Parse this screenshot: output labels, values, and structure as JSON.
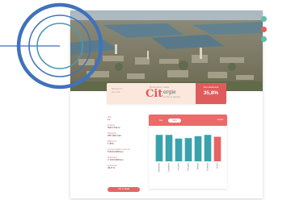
{
  "infobar": {
    "left_caption_line1": "Rendement",
    "left_caption_line2": "de la ville",
    "context_label": "Bienvenue dans",
    "logo_cit": "Cit",
    "logo_ergie": "ergie",
    "logo_tagline": "la ville en énergie",
    "score_label": "Taux d'autonomie",
    "score_value": "35,8%"
  },
  "fields": [
    {
      "label": "Ville",
      "value": "Le"
    },
    {
      "label": "Quartier",
      "value": "Saint-Pierre"
    },
    {
      "label": "Habitants",
      "value": "250 000 hab."
    },
    {
      "label": "Bâtiments",
      "value": "1 850"
    },
    {
      "label": "Consommation moyenne",
      "value": "5 800 MWh/an"
    },
    {
      "label": "Production",
      "value": "2 100 MWh/an"
    },
    {
      "label": "Autonomie",
      "value": "35,8 %"
    }
  ],
  "cta_label": "Voir le détail",
  "chart_header": {
    "tab1": "Jour",
    "tab2": "Mois",
    "right_label": "Année"
  },
  "colors": {
    "accent": "#e05b5b",
    "bar": "#3aa2ad",
    "bar_highlight": "#e56565",
    "side_teal": "#5fbfa7",
    "side_red": "#e45f5f"
  },
  "chart_data": {
    "type": "bar",
    "categories": [
      "Résidentiel",
      "Commerce",
      "Industrie",
      "Transport",
      "Tertiaire",
      "Éclairage",
      "Autres"
    ],
    "values": [
      100,
      100,
      86,
      88,
      95,
      100,
      93
    ],
    "highlight_index": 6,
    "ylim": [
      0,
      110
    ]
  }
}
